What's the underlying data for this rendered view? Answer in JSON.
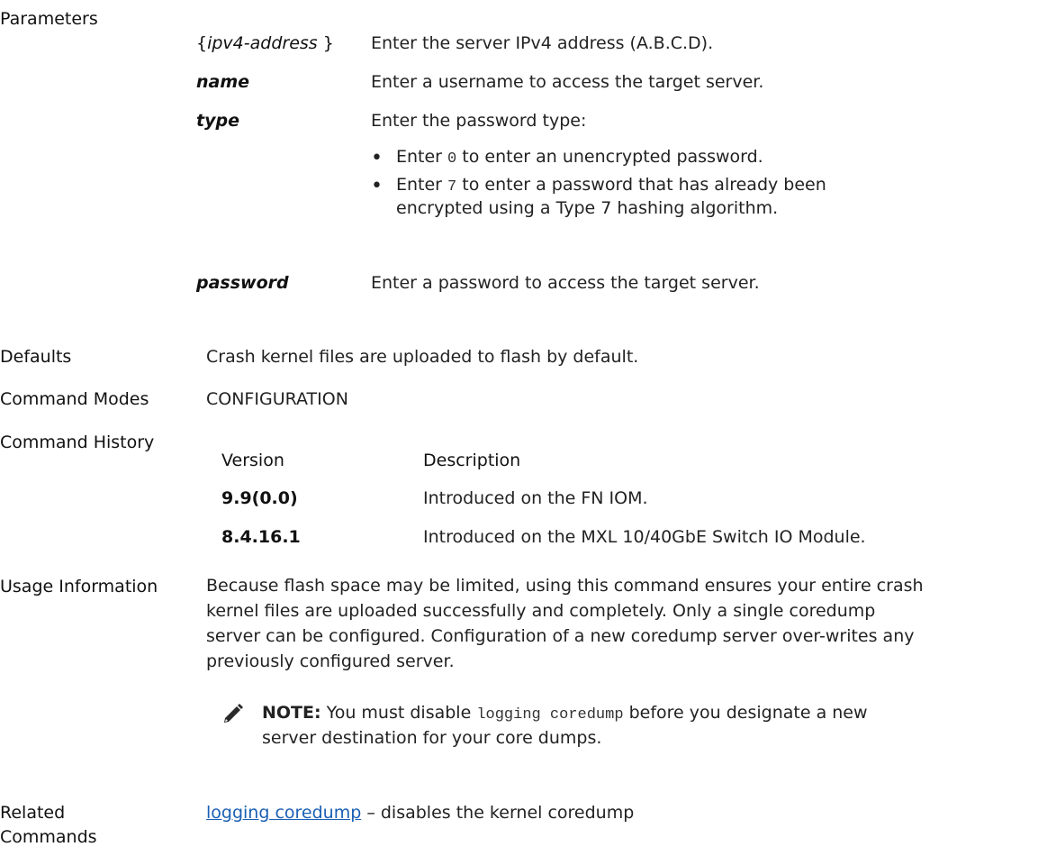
{
  "parameters": {
    "label": "Parameters",
    "rows": [
      {
        "name_open": "{",
        "name": "ipv4-address",
        "name_close": " }",
        "desc": "Enter the server IPv4 address (A.B.C.D)."
      },
      {
        "name": "name",
        "desc": "Enter a username to access the target server."
      },
      {
        "name": "type",
        "desc": "Enter the password type:"
      },
      {
        "name": "password",
        "desc": "Enter a password to access the target server."
      }
    ],
    "type_bullets": [
      {
        "pre": "Enter ",
        "code": "0",
        "post": " to enter an unencrypted password."
      },
      {
        "pre": "Enter ",
        "code": "7",
        "post": " to enter a password that has already been",
        "line2": "encrypted using a Type 7 hashing algorithm."
      }
    ]
  },
  "defaults": {
    "label": "Defaults",
    "text": "Crash kernel files are uploaded to flash by default."
  },
  "command_modes": {
    "label": "Command Modes",
    "text": "CONFIGURATION"
  },
  "command_history": {
    "label": "Command History",
    "headers": [
      "Version",
      "Description"
    ],
    "rows": [
      {
        "version": "9.9(0.0)",
        "description": "Introduced on the FN IOM."
      },
      {
        "version": "8.4.16.1",
        "description": "Introduced on the MXL 10/40GbE Switch IO Module."
      }
    ]
  },
  "usage": {
    "label": "Usage Information",
    "lines": [
      "Because flash space may be limited, using this command ensures your entire crash",
      "kernel files are uploaded successfully and completely. Only a single coredump",
      "server can be configured. Configuration of a new coredump server over-writes any",
      "previously configured server."
    ],
    "note": {
      "icon": "pencil-note-icon",
      "label": "NOTE:",
      "pre": " You must disable ",
      "code": "logging coredump",
      "post": " before you designate a new",
      "line2": "server destination for your core dumps."
    }
  },
  "related": {
    "label_line1": "Related",
    "label_line2": "Commands",
    "link_text": "logging coredump",
    "text": " – disables the kernel coredump"
  }
}
